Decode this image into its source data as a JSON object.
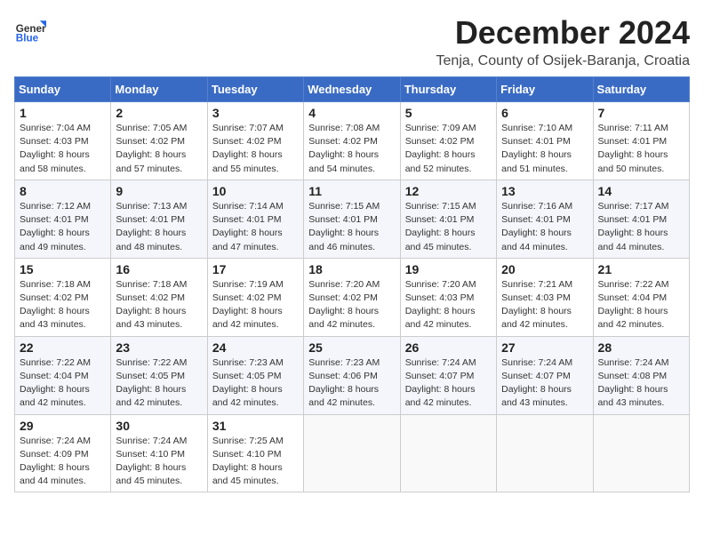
{
  "logo": {
    "general": "General",
    "blue": "Blue"
  },
  "header": {
    "month": "December 2024",
    "location": "Tenja, County of Osijek-Baranja, Croatia"
  },
  "weekdays": [
    "Sunday",
    "Monday",
    "Tuesday",
    "Wednesday",
    "Thursday",
    "Friday",
    "Saturday"
  ],
  "weeks": [
    [
      {
        "day": 1,
        "info": "Sunrise: 7:04 AM\nSunset: 4:03 PM\nDaylight: 8 hours\nand 58 minutes."
      },
      {
        "day": 2,
        "info": "Sunrise: 7:05 AM\nSunset: 4:02 PM\nDaylight: 8 hours\nand 57 minutes."
      },
      {
        "day": 3,
        "info": "Sunrise: 7:07 AM\nSunset: 4:02 PM\nDaylight: 8 hours\nand 55 minutes."
      },
      {
        "day": 4,
        "info": "Sunrise: 7:08 AM\nSunset: 4:02 PM\nDaylight: 8 hours\nand 54 minutes."
      },
      {
        "day": 5,
        "info": "Sunrise: 7:09 AM\nSunset: 4:02 PM\nDaylight: 8 hours\nand 52 minutes."
      },
      {
        "day": 6,
        "info": "Sunrise: 7:10 AM\nSunset: 4:01 PM\nDaylight: 8 hours\nand 51 minutes."
      },
      {
        "day": 7,
        "info": "Sunrise: 7:11 AM\nSunset: 4:01 PM\nDaylight: 8 hours\nand 50 minutes."
      }
    ],
    [
      {
        "day": 8,
        "info": "Sunrise: 7:12 AM\nSunset: 4:01 PM\nDaylight: 8 hours\nand 49 minutes."
      },
      {
        "day": 9,
        "info": "Sunrise: 7:13 AM\nSunset: 4:01 PM\nDaylight: 8 hours\nand 48 minutes."
      },
      {
        "day": 10,
        "info": "Sunrise: 7:14 AM\nSunset: 4:01 PM\nDaylight: 8 hours\nand 47 minutes."
      },
      {
        "day": 11,
        "info": "Sunrise: 7:15 AM\nSunset: 4:01 PM\nDaylight: 8 hours\nand 46 minutes."
      },
      {
        "day": 12,
        "info": "Sunrise: 7:15 AM\nSunset: 4:01 PM\nDaylight: 8 hours\nand 45 minutes."
      },
      {
        "day": 13,
        "info": "Sunrise: 7:16 AM\nSunset: 4:01 PM\nDaylight: 8 hours\nand 44 minutes."
      },
      {
        "day": 14,
        "info": "Sunrise: 7:17 AM\nSunset: 4:01 PM\nDaylight: 8 hours\nand 44 minutes."
      }
    ],
    [
      {
        "day": 15,
        "info": "Sunrise: 7:18 AM\nSunset: 4:02 PM\nDaylight: 8 hours\nand 43 minutes."
      },
      {
        "day": 16,
        "info": "Sunrise: 7:18 AM\nSunset: 4:02 PM\nDaylight: 8 hours\nand 43 minutes."
      },
      {
        "day": 17,
        "info": "Sunrise: 7:19 AM\nSunset: 4:02 PM\nDaylight: 8 hours\nand 42 minutes."
      },
      {
        "day": 18,
        "info": "Sunrise: 7:20 AM\nSunset: 4:02 PM\nDaylight: 8 hours\nand 42 minutes."
      },
      {
        "day": 19,
        "info": "Sunrise: 7:20 AM\nSunset: 4:03 PM\nDaylight: 8 hours\nand 42 minutes."
      },
      {
        "day": 20,
        "info": "Sunrise: 7:21 AM\nSunset: 4:03 PM\nDaylight: 8 hours\nand 42 minutes."
      },
      {
        "day": 21,
        "info": "Sunrise: 7:22 AM\nSunset: 4:04 PM\nDaylight: 8 hours\nand 42 minutes."
      }
    ],
    [
      {
        "day": 22,
        "info": "Sunrise: 7:22 AM\nSunset: 4:04 PM\nDaylight: 8 hours\nand 42 minutes."
      },
      {
        "day": 23,
        "info": "Sunrise: 7:22 AM\nSunset: 4:05 PM\nDaylight: 8 hours\nand 42 minutes."
      },
      {
        "day": 24,
        "info": "Sunrise: 7:23 AM\nSunset: 4:05 PM\nDaylight: 8 hours\nand 42 minutes."
      },
      {
        "day": 25,
        "info": "Sunrise: 7:23 AM\nSunset: 4:06 PM\nDaylight: 8 hours\nand 42 minutes."
      },
      {
        "day": 26,
        "info": "Sunrise: 7:24 AM\nSunset: 4:07 PM\nDaylight: 8 hours\nand 42 minutes."
      },
      {
        "day": 27,
        "info": "Sunrise: 7:24 AM\nSunset: 4:07 PM\nDaylight: 8 hours\nand 43 minutes."
      },
      {
        "day": 28,
        "info": "Sunrise: 7:24 AM\nSunset: 4:08 PM\nDaylight: 8 hours\nand 43 minutes."
      }
    ],
    [
      {
        "day": 29,
        "info": "Sunrise: 7:24 AM\nSunset: 4:09 PM\nDaylight: 8 hours\nand 44 minutes."
      },
      {
        "day": 30,
        "info": "Sunrise: 7:24 AM\nSunset: 4:10 PM\nDaylight: 8 hours\nand 45 minutes."
      },
      {
        "day": 31,
        "info": "Sunrise: 7:25 AM\nSunset: 4:10 PM\nDaylight: 8 hours\nand 45 minutes."
      },
      null,
      null,
      null,
      null
    ]
  ]
}
